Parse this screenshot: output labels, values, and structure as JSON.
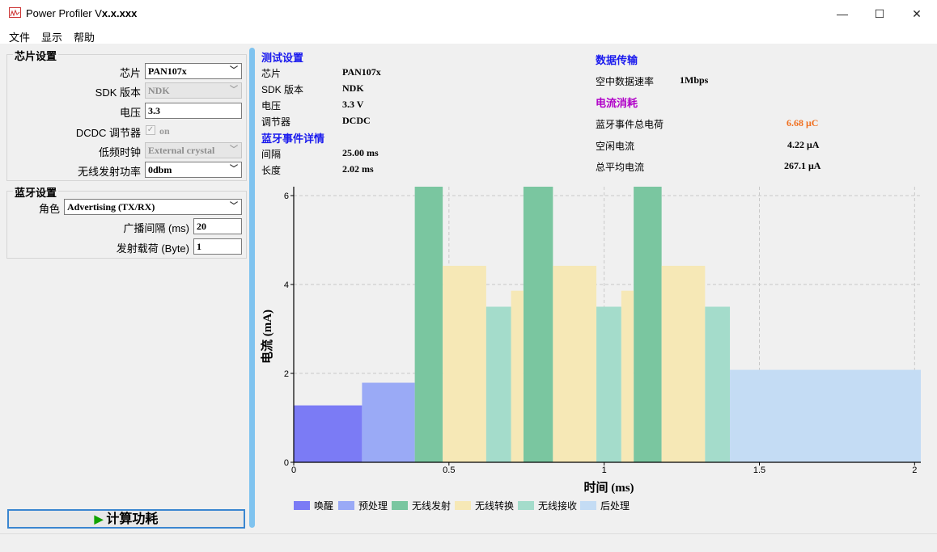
{
  "window": {
    "title": "Power Profiler V",
    "title_bold": "x.x.xxx",
    "minimize": "—",
    "maximize": "☐",
    "close": "✕"
  },
  "menu": [
    "文件",
    "显示",
    "帮助"
  ],
  "chip_settings": {
    "title": "芯片设置",
    "chip_label": "芯片",
    "chip_value": "PAN107x",
    "sdk_label": "SDK 版本",
    "sdk_value": "NDK",
    "voltage_label": "电压",
    "voltage_value": "3.3",
    "dcdc_label": "DCDC 调节器",
    "dcdc_value": "on",
    "dcdc_checked": true,
    "lf_clock_label": "低频时钟",
    "lf_clock_value": "External crystal",
    "tx_power_label": "无线发射功率",
    "tx_power_value": "0dbm"
  },
  "bt_settings": {
    "title": "蓝牙设置",
    "role_label": "角色",
    "role_value": "Advertising (TX/RX)",
    "adv_interval_label": "广播间隔 (ms)",
    "adv_interval_value": "20",
    "payload_label": "发射载荷 (Byte)",
    "payload_value": "1"
  },
  "calc_button": {
    "icon": "▶",
    "label": "计算功耗"
  },
  "summary": {
    "test_settings": {
      "title": "测试设置",
      "rows": [
        {
          "key": "芯片",
          "value": "PAN107x"
        },
        {
          "key": "SDK 版本",
          "value": "NDK"
        },
        {
          "key": "电压",
          "value": "3.3 V"
        },
        {
          "key": "调节器",
          "value": "DCDC"
        }
      ]
    },
    "bt_event": {
      "title": "蓝牙事件详情",
      "rows": [
        {
          "key": "间隔",
          "value": "25.00 ms"
        },
        {
          "key": "长度",
          "value": "2.02 ms"
        }
      ]
    },
    "data_transfer": {
      "title": "数据传输",
      "rows": [
        {
          "key": "空中数据速率",
          "value": "1Mbps"
        }
      ]
    },
    "current": {
      "title": "电流消耗",
      "rows": [
        {
          "key": "蓝牙事件总电荷",
          "value": "6.68 μC",
          "color": "#f07020"
        },
        {
          "key": "空闲电流",
          "value": "4.22 μA"
        },
        {
          "key": "总平均电流",
          "value": "267.1 μA"
        }
      ]
    }
  },
  "chart_data": {
    "type": "bar",
    "xlabel": "时间 (ms)",
    "ylabel": "电流 (mA)",
    "xlim": [
      0,
      2.02
    ],
    "ylim": [
      0,
      6.2
    ],
    "x_ticks": [
      0,
      0.5,
      1,
      1.5,
      2
    ],
    "x_tick_labels": [
      "0",
      "0.5",
      "1",
      "1.5",
      "2"
    ],
    "y_ticks": [
      0,
      2,
      4,
      6
    ],
    "y_tick_labels": [
      "0",
      "2",
      "4",
      "6"
    ],
    "grid": true,
    "legend_position": "bottom",
    "series": [
      {
        "name": "唤醒",
        "color": "#7b7bf5",
        "segments": [
          {
            "start": 0,
            "end": 0.22,
            "value": 1.28
          }
        ]
      },
      {
        "name": "预处理",
        "color": "#9aaaf6",
        "segments": [
          {
            "start": 0.22,
            "end": 0.39,
            "value": 1.79
          }
        ]
      },
      {
        "name": "无线发射",
        "color": "#7ac6a0",
        "segments": [
          {
            "start": 0.39,
            "end": 0.48,
            "value": 6.2
          },
          {
            "start": 0.74,
            "end": 0.835,
            "value": 6.2
          },
          {
            "start": 1.095,
            "end": 1.185,
            "value": 6.2
          }
        ]
      },
      {
        "name": "无线转换",
        "color": "#f6e8b6",
        "segments": [
          {
            "start": 0.48,
            "end": 0.62,
            "value": 4.42
          },
          {
            "start": 0.7,
            "end": 0.74,
            "value": 3.86
          },
          {
            "start": 0.835,
            "end": 0.975,
            "value": 4.42
          },
          {
            "start": 1.055,
            "end": 1.095,
            "value": 3.86
          },
          {
            "start": 1.185,
            "end": 1.325,
            "value": 4.42
          }
        ]
      },
      {
        "name": "无线接收",
        "color": "#a4dccb",
        "segments": [
          {
            "start": 0.62,
            "end": 0.7,
            "value": 3.5
          },
          {
            "start": 0.975,
            "end": 1.055,
            "value": 3.5
          },
          {
            "start": 1.325,
            "end": 1.405,
            "value": 3.5
          }
        ]
      },
      {
        "name": "后处理",
        "color": "#c4dcf4",
        "segments": [
          {
            "start": 1.405,
            "end": 2.02,
            "value": 2.08
          }
        ]
      }
    ]
  }
}
